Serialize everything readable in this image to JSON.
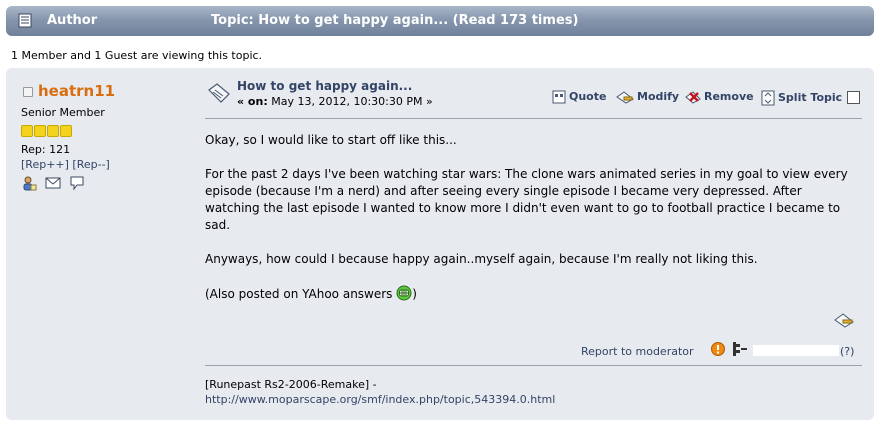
{
  "header": {
    "author_label": "Author",
    "topic_label": "Topic: How to get happy again...  (Read 173 times)"
  },
  "viewing_text": "1 Member and 1 Guest are viewing this topic.",
  "poster": {
    "username": "heatrn11",
    "group": "Senior Member",
    "star_count": 4,
    "rep": "Rep: 121",
    "rep_plus": "[Rep++]",
    "rep_minus": "[Rep--]"
  },
  "post": {
    "subject": "How to get happy again...",
    "date_prefix": "« on:",
    "date": "May 13, 2012, 10:30:30 PM »",
    "buttons": {
      "quote": "Quote",
      "modify": "Modify",
      "remove": "Remove",
      "split": "Split Topic"
    },
    "paragraphs": [
      "Okay, so I would like to start off like this...",
      "For the past 2 days I've been watching star wars: The clone wars animated series in my goal to view every episode (because I'm a nerd) and after seeing every single episode I became very depressed. After watching the last episode I wanted to know more I didn't even want to go to football practice I became to sad.",
      "Anyways, how could I because happy again..myself again, because I'm really not liking this."
    ],
    "last_line": "(Also posted on YAhoo answers",
    "report_link": "Report to moderator",
    "ip_help": "(?)",
    "signature_line1": "[Runepast Rs2-2006-Remake] -",
    "signature_line2": "http://www.moparscape.org/smf/index.php/topic,543394.0.html"
  },
  "colors": {
    "header_bar": "#8696ad",
    "post_bg": "#e7eaef",
    "username": "#d96e11",
    "link": "#334466"
  }
}
